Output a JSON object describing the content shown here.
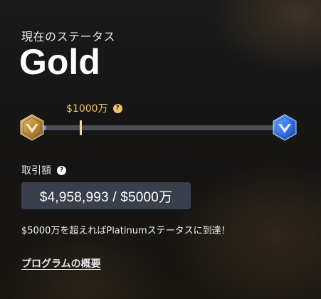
{
  "status": {
    "label": "現在のステータス",
    "tier": "Gold"
  },
  "progress": {
    "threshold_label": "$1000万",
    "help_glyph": "?",
    "filled_fraction": 0.06,
    "marker_fraction": 0.19,
    "current_tier_icon": "gold-tier-icon",
    "next_tier_icon": "platinum-tier-icon"
  },
  "trading_volume": {
    "label": "取引額",
    "help_glyph": "?",
    "value": "$4,958,993 / $5000万"
  },
  "upgrade_note": "$5000万を超えればPlatinumステータスに到達！",
  "program_link": "プログラムの概要",
  "colors": {
    "accent_gold": "#f0c56a",
    "progress_blue": "#3e8cf0",
    "track": "#4a4f57",
    "value_box": "#3a404b"
  }
}
